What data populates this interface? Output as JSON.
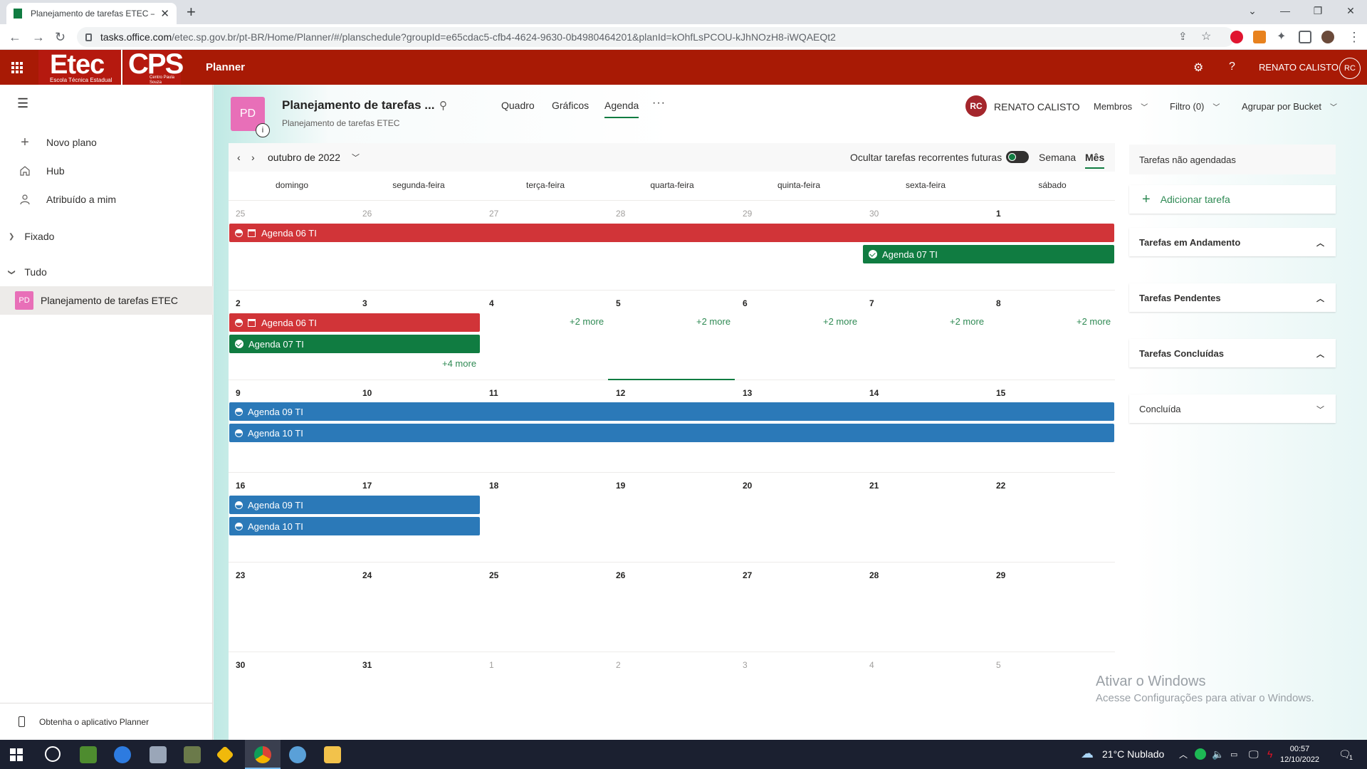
{
  "browser": {
    "tab_title": "Planejamento de tarefas ETEC – P",
    "url_domain": "tasks.office.com",
    "url_path": "/etec.sp.gov.br/pt-BR/Home/Planner/#/planschedule?groupId=e65cdac5-cfb4-4624-9630-0b4980464201&planId=kOhfLsPCOU-kJhNOzH8-iWQAEQt2"
  },
  "office_header": {
    "logo_etec": "Etec",
    "logo_etec_sub": "Escola Técnica Estadual",
    "logo_cps": "CPS",
    "logo_cps_sub": "Centro Paula Souza",
    "app_name": "Planner",
    "user_name": "RENATO CALISTO",
    "user_initials": "RC"
  },
  "left_nav": {
    "items": [
      {
        "label": "Novo plano",
        "icon": "plus-icon"
      },
      {
        "label": "Hub",
        "icon": "home-icon"
      },
      {
        "label": "Atribuído a mim",
        "icon": "person-icon"
      }
    ],
    "sections": [
      "Fixado",
      "Tudo"
    ],
    "plan": {
      "initials": "PD",
      "label": "Planejamento de tarefas ETEC"
    },
    "get_app": "Obtenha o aplicativo Planner"
  },
  "plan_header": {
    "initials": "PD",
    "title": "Planejamento de tarefas ...",
    "subtitle": "Planejamento de tarefas ETEC",
    "views": [
      "Quadro",
      "Gráficos",
      "Agenda"
    ],
    "active_view": "Agenda",
    "owner_initials": "RC",
    "owner_name": "RENATO CALISTO",
    "members": "Membros",
    "filter": "Filtro (0)",
    "group_by": "Agrupar por Bucket"
  },
  "calendar": {
    "month_label": "outubro de 2022",
    "hide_recurring": "Ocultar tarefas recorrentes futuras",
    "week_label": "Semana",
    "month_btn": "Mês",
    "weekdays": [
      "domingo",
      "segunda-feira",
      "terça-feira",
      "quarta-feira",
      "quinta-feira",
      "sexta-feira",
      "sábado"
    ],
    "weeks": [
      [
        "25",
        "26",
        "27",
        "28",
        "29",
        "30",
        "1"
      ],
      [
        "2",
        "3",
        "4",
        "5",
        "6",
        "7",
        "8"
      ],
      [
        "9",
        "10",
        "11",
        "12",
        "13",
        "14",
        "15"
      ],
      [
        "16",
        "17",
        "18",
        "19",
        "20",
        "21",
        "22"
      ],
      [
        "23",
        "24",
        "25",
        "26",
        "27",
        "28",
        "29"
      ],
      [
        "30",
        "31",
        "1",
        "2",
        "3",
        "4",
        "5"
      ]
    ],
    "events": {
      "agenda06": "Agenda 06 TI",
      "agenda07": "Agenda 07 TI",
      "agenda09": "Agenda 09 TI",
      "agenda10": "Agenda 10 TI"
    },
    "more_2": "+2 more",
    "more_4": "+4 more"
  },
  "right_panel": {
    "unscheduled": "Tarefas não agendadas",
    "add_task": "Adicionar tarefa",
    "groups": [
      "Tarefas em Andamento",
      "Tarefas Pendentes",
      "Tarefas Concluídas",
      "Concluída"
    ]
  },
  "watermark": {
    "line1": "Ativar o Windows",
    "line2": "Acesse Configurações para ativar o Windows."
  },
  "taskbar": {
    "weather": "21°C  Nublado",
    "time": "00:57",
    "date": "12/10/2022",
    "notif_count": "1"
  },
  "colors": {
    "header": "#a81a05",
    "accent": "#107c41",
    "event_red": "#d13438",
    "event_green": "#107c41",
    "event_blue": "#2b79b8",
    "plan_pink": "#e86fb8"
  }
}
